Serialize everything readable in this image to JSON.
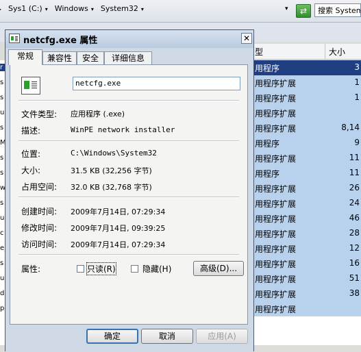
{
  "explorer": {
    "breadcrumb": [
      "Sys1 (C:)",
      "Windows",
      "System32"
    ],
    "search_placeholder": "搜索 System",
    "columns": {
      "type": "型",
      "size": "大小"
    },
    "rows": [
      {
        "type": "用程序",
        "size": "3"
      },
      {
        "type": "用程序扩展",
        "size": "1"
      },
      {
        "type": "用程序扩展",
        "size": "1"
      },
      {
        "type": "用程序扩展",
        "size": ""
      },
      {
        "type": "用程序扩展",
        "size": "8,14"
      },
      {
        "type": "用程序",
        "size": "9"
      },
      {
        "type": "用程序扩展",
        "size": "11"
      },
      {
        "type": "用程序",
        "size": "11"
      },
      {
        "type": "用程序扩展",
        "size": "26"
      },
      {
        "type": "用程序扩展",
        "size": "24"
      },
      {
        "type": "用程序扩展",
        "size": "46"
      },
      {
        "type": "用程序扩展",
        "size": "28"
      },
      {
        "type": "用程序扩展",
        "size": "12"
      },
      {
        "type": "用程序扩展",
        "size": "16"
      },
      {
        "type": "用程序扩展",
        "size": "51"
      },
      {
        "type": "用程序扩展",
        "size": "38"
      },
      {
        "type": "用程序扩展",
        "size": ""
      }
    ],
    "left_strip": [
      "r",
      "s",
      "s",
      "u",
      "s",
      "M",
      "s",
      "s",
      "w",
      "s",
      "u",
      "c",
      "e",
      "s",
      "u",
      "d",
      "p"
    ]
  },
  "dialog": {
    "title": "netcfg.exe 属性",
    "tabs": [
      "常规",
      "兼容性",
      "安全",
      "详细信息"
    ],
    "file_name": "netcfg.exe",
    "fields": {
      "type_label": "文件类型:",
      "type_value": "应用程序 (.exe)",
      "desc_label": "描述:",
      "desc_value": "WinPE network installer",
      "location_label": "位置:",
      "location_value": "C:\\Windows\\System32",
      "size_label": "大小:",
      "size_value": "31.5 KB (32,256 字节)",
      "disk_label": "占用空间:",
      "disk_value": "32.0 KB (32,768 字节)",
      "created_label": "创建时间:",
      "created_value": "2009年7月14日, 07:29:34",
      "modified_label": "修改时间:",
      "modified_value": "2009年7月14日, 09:39:25",
      "accessed_label": "访问时间:",
      "accessed_value": "2009年7月14日, 07:29:34",
      "attr_label": "属性:"
    },
    "readonly_label": "只读(R)",
    "hidden_label": "隐藏(H)",
    "advanced_label": "高级(D)...",
    "buttons": {
      "ok": "确定",
      "cancel": "取消",
      "apply": "应用(A)"
    }
  }
}
